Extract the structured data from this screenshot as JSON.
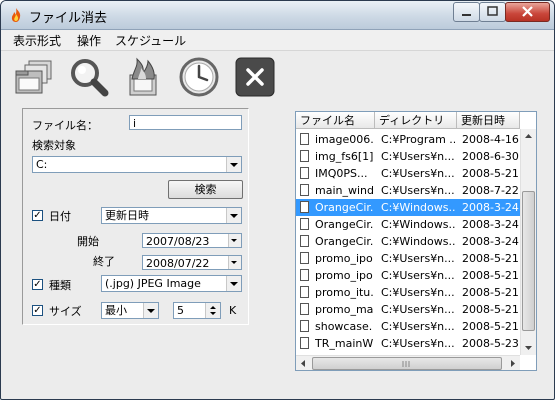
{
  "window": {
    "title": "ファイル消去",
    "accent": "#3399ff"
  },
  "menu": [
    "表示形式",
    "操作",
    "スケジュール"
  ],
  "toolbar": {
    "icons": [
      "folders-icon",
      "magnifier-icon",
      "fire-icon",
      "clock-icon",
      "close-x-icon"
    ],
    "close_glyph": "×"
  },
  "search": {
    "filename_label": "ファイル名：",
    "filename_value": "i",
    "target_label": "検索対象",
    "target_value": "C:",
    "search_button": "検索",
    "date": {
      "label": "日付",
      "checked": "✓",
      "type_value": "更新日時",
      "start_label": "開始",
      "start_value": "2007/08/23",
      "end_label": "終了",
      "end_value": "2008/07/22"
    },
    "kind": {
      "label": "種類",
      "checked": "✓",
      "value": "(.jpg) JPEG Image"
    },
    "size": {
      "label": "サイズ",
      "checked": "✓",
      "mode_value": "最小",
      "amount": "5",
      "unit": "K"
    }
  },
  "results": {
    "columns": [
      "ファイル名",
      "ディレクトリ",
      "更新日時"
    ],
    "rows": [
      {
        "name": "image006...",
        "dir": "C:¥Program ...",
        "date": "2008-4-16"
      },
      {
        "name": "img_fs6[1]...",
        "dir": "C:¥Users¥n...",
        "date": "2008-6-30"
      },
      {
        "name": "IMQ0PS...",
        "dir": "C:¥Users¥n...",
        "date": "2008-5-21"
      },
      {
        "name": "main_wind...",
        "dir": "C:¥Users¥n...",
        "date": "2008-7-22"
      },
      {
        "name": "OrangeCir...",
        "dir": "C:¥Windows...",
        "date": "2008-3-24"
      },
      {
        "name": "OrangeCir...",
        "dir": "C:¥Windows...",
        "date": "2008-3-24"
      },
      {
        "name": "OrangeCir...",
        "dir": "C:¥Windows...",
        "date": "2008-3-24"
      },
      {
        "name": "promo_ipo...",
        "dir": "C:¥Users¥n...",
        "date": "2008-5-21"
      },
      {
        "name": "promo_ipo...",
        "dir": "C:¥Users¥n...",
        "date": "2008-5-21"
      },
      {
        "name": "promo_itu...",
        "dir": "C:¥Users¥n...",
        "date": "2008-5-21"
      },
      {
        "name": "promo_ma...",
        "dir": "C:¥Users¥n...",
        "date": "2008-5-21"
      },
      {
        "name": "showcase...",
        "dir": "C:¥Users¥n...",
        "date": "2008-5-21"
      },
      {
        "name": "TR_mainW...",
        "dir": "C:¥Users¥n...",
        "date": "2008-5-23"
      }
    ],
    "selected_index": 4
  }
}
